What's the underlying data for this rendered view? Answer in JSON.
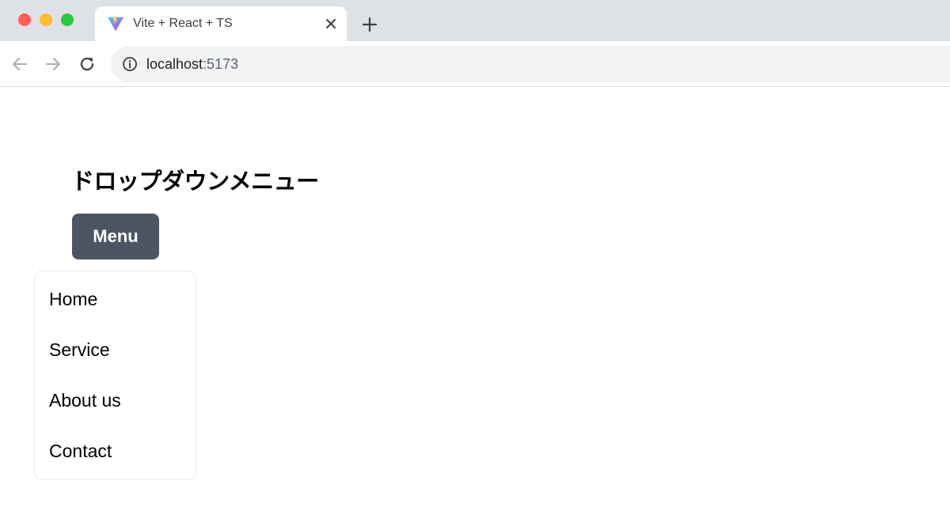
{
  "browser": {
    "tab": {
      "title": "Vite + React + TS",
      "favicon": "vite-logo-icon"
    },
    "address": {
      "host": "localhost",
      "port": ":5173"
    },
    "colors": {
      "tabstrip": "#dee1e6",
      "omnibox": "#f1f3f4"
    }
  },
  "page": {
    "title": "ドロップダウンメニュー",
    "menu_button_label": "Menu",
    "menu_items": [
      {
        "label": "Home"
      },
      {
        "label": "Service"
      },
      {
        "label": "About us"
      },
      {
        "label": "Contact"
      }
    ],
    "colors": {
      "button_bg": "#4b5563",
      "button_text": "#ffffff",
      "dropdown_border": "#e5e7eb"
    }
  }
}
